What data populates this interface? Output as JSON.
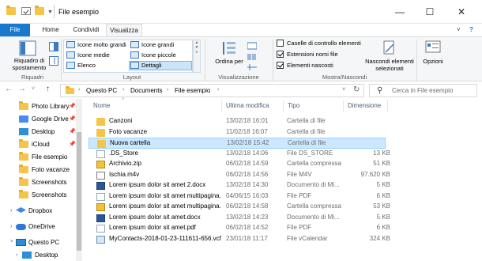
{
  "window": {
    "title": "File esempio",
    "minimize": "—",
    "maximize": "☐",
    "close": "✕"
  },
  "tabs": {
    "file": "File",
    "home": "Home",
    "share": "Condividi",
    "view": "Visualizza"
  },
  "ribbon": {
    "panes": {
      "nav_pane_label": "Riquadro di spostamento",
      "group_label": "Riquadri"
    },
    "layout": {
      "items": [
        "Icone molto grandi",
        "Icone grandi",
        "Icone medie",
        "Icone piccole",
        "Elenco",
        "Dettagli"
      ],
      "group_label": "Layout",
      "selected": "Dettagli"
    },
    "current_view": {
      "sort_label": "Ordina per",
      "group_label": "Visualizzazione corrente"
    },
    "show_hide": {
      "checkboxes": [
        {
          "label": "Caselle di controllo elementi",
          "checked": false
        },
        {
          "label": "Estensioni nomi file",
          "checked": true
        },
        {
          "label": "Elementi nascosti",
          "checked": true
        }
      ],
      "hide_selected": "Nascondi elementi selezionati",
      "group_label": "Mostra/Nascondi"
    },
    "options": {
      "label": "Opzioni"
    }
  },
  "address": {
    "breadcrumb": [
      "Questo PC",
      "Documents",
      "File esempio"
    ],
    "search_placeholder": "Cerca in File esempio"
  },
  "nav": {
    "items": [
      {
        "label": "Photo Library",
        "pinned": true
      },
      {
        "label": "Google Drive",
        "pinned": true
      },
      {
        "label": "Desktop",
        "pinned": true
      },
      {
        "label": "iCloud",
        "pinned": true
      },
      {
        "label": "File esempio",
        "pinned": false
      },
      {
        "label": "Foto vacanze",
        "pinned": false
      },
      {
        "label": "Screenshots",
        "pinned": false
      },
      {
        "label": "Screenshots",
        "pinned": false
      },
      {
        "label": "Dropbox",
        "pinned": false
      },
      {
        "label": "OneDrive",
        "pinned": false
      },
      {
        "label": "Questo PC",
        "pinned": false
      },
      {
        "label": "Desktop",
        "pinned": false
      }
    ]
  },
  "files": {
    "headers": {
      "name": "Nome",
      "modified": "Ultima modifica",
      "type": "Tipo",
      "size": "Dimensione"
    },
    "rows": [
      {
        "name": "Canzoni",
        "date": "13/02/18 16:01",
        "type": "Cartella di file",
        "size": "",
        "icon": "folder-icon"
      },
      {
        "name": "Foto vacanze",
        "date": "11/02/18 16:07",
        "type": "Cartella di file",
        "size": "",
        "icon": "folder-icon"
      },
      {
        "name": "Nuova cartella",
        "date": "13/02/18 15:42",
        "type": "Cartella di file",
        "size": "",
        "icon": "folder-icon"
      },
      {
        "name": ".DS_Store",
        "date": "13/02/18 14:06",
        "type": "File DS_STORE",
        "size": "13 KB",
        "icon": "document-icon"
      },
      {
        "name": "Archivio.zip",
        "date": "06/02/18 14:59",
        "type": "Cartella compressa",
        "size": "51 KB",
        "icon": "zip-icon"
      },
      {
        "name": "Ischia.m4v",
        "date": "06/02/18 14:56",
        "type": "File M4V",
        "size": "97.620 KB",
        "icon": "video-icon"
      },
      {
        "name": "Lorem ipsum dolor sit amet 2.docx",
        "date": "13/02/18 14:30",
        "type": "Documento di Mi...",
        "size": "5 KB",
        "icon": "word-icon"
      },
      {
        "name": "Lorem ipsum dolor sit amet multipagina....",
        "date": "04/06/15 16:03",
        "type": "File PDF",
        "size": "6 KB",
        "icon": "pdf-icon"
      },
      {
        "name": "Lorem ipsum dolor sit amet multipagina....",
        "date": "06/02/18 14:58",
        "type": "Cartella compressa",
        "size": "53 KB",
        "icon": "zip-icon"
      },
      {
        "name": "Lorem ipsum dolor sit amet.docx",
        "date": "13/02/18 14:23",
        "type": "Documento di Mi...",
        "size": "5 KB",
        "icon": "word-icon"
      },
      {
        "name": "Lorem ipsum dolor sit amet.pdf",
        "date": "06/02/18 14:52",
        "type": "File PDF",
        "size": "6 KB",
        "icon": "pdf-icon"
      },
      {
        "name": "MyContacts-2018-01-23-111611-656.vcf",
        "date": "23/01/18 11:17",
        "type": "File vCalendar",
        "size": "324 KB",
        "icon": "vcard-icon"
      }
    ],
    "selected_index": 2
  },
  "colors": {
    "accent": "#1979ca",
    "selection": "#cce8ff",
    "folder": "#f5c54a"
  }
}
